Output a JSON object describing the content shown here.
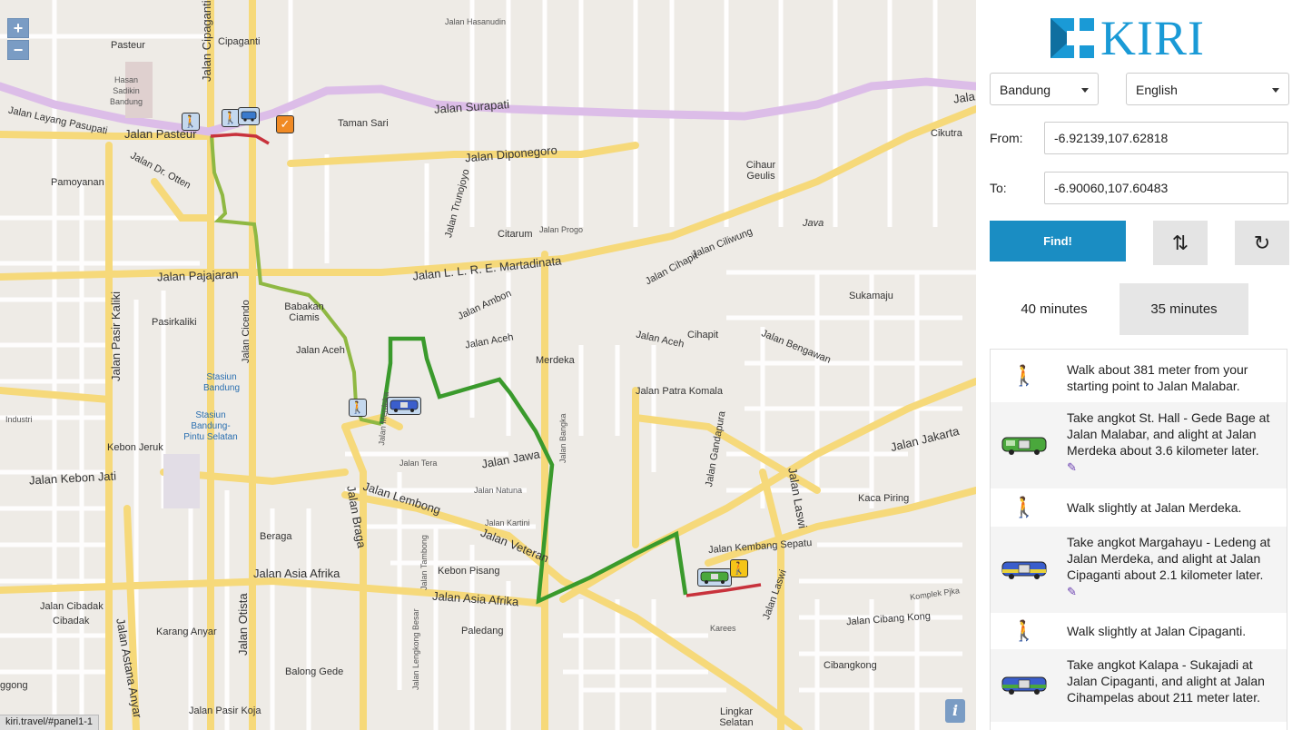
{
  "map": {
    "zoom_in": "+",
    "zoom_out": "−",
    "info": "i",
    "status_url": "kiri.travel/#panel1-1",
    "places": {
      "pasteur": "Pasteur",
      "cipaganti": "Cipaganti",
      "hasan": "Hasan Sadikin Bandung",
      "taman_sari": "Taman Sari",
      "pamoyanan": "Pamoyanan",
      "cihaur": "Cihaur Geulis",
      "citarum": "Citarum",
      "java": "Java",
      "cikutra": "Cikutra",
      "babakan": "Babakan Ciamis",
      "pasirkaliki": "Pasirkaliki",
      "sukamaju": "Sukamaju",
      "merdeka": "Merdeka",
      "cihapit": "Cihapit",
      "stasiun": "Stasiun Bandung",
      "stasiun2": "Stasiun Bandung-Pintu Selatan",
      "kebon_jeruk": "Kebon Jeruk",
      "kaca_piring": "Kaca Piring",
      "beraga": "Beraga",
      "kebon_pisang": "Kebon Pisang",
      "cibadak": "Cibadak",
      "karang_anyar": "Karang Anyar",
      "paledang": "Paledang",
      "balong_gede": "Balong Gede",
      "cibangkong": "Cibangkong",
      "lingkar": "Lingkar Selatan",
      "ggong": "ggong"
    },
    "streets": {
      "hasanudin": "Jalan Hasanudin",
      "surapati": "Jalan Surapati",
      "layang": "Jalan Layang Pasupati",
      "pasteur": "Jalan Pasteur",
      "dipongoro": "Jalan Diponegoro",
      "dr_otten": "Jalan Dr. Otten",
      "pajajaran": "Jalan Pajajaran",
      "martadinata": "Jalan L. L. R. E. Martadinata",
      "ambon": "Jalan Ambon",
      "aceh": "Jalan Aceh",
      "aceh2": "Jalan Aceh",
      "aceh3": "Jalan Aceh",
      "cihapit": "Jalan Cihapit",
      "ciliwung": "Jalan Ciliwung",
      "cipaganti": "Jalan Cipaganti",
      "cicendo": "Jalan Cicendo",
      "pasir_kaliki": "Jalan Pasir Kaliki",
      "kebon_jati": "Jalan Kebon Jati",
      "jawa": "Jalan Jawa",
      "lembong": "Jalan Lembong",
      "veteran": "Jalan Veteran",
      "asia_afrika": "Jalan Asia Afrika",
      "asia_afrika2": "Jalan Asia Afrika",
      "braga": "Jalan Braga",
      "otista": "Jalan Otista",
      "laswi": "Jalan Laswi",
      "laswi2": "Jalan Laswi",
      "jakarta": "Jalan Jakarta",
      "gandapura": "Jalan Gandapura",
      "kembang_sepatu": "Jalan Kembang Sepatu",
      "astana_anyar": "Jalan Astana Anyar",
      "pasir_koja": "Jalan Pasir Koja",
      "cibadak": "Jalan Cibadak",
      "cibang_kong": "Jalan Cibang Kong",
      "bengawan": "Jalan Bengawan",
      "patra": "Jalan Patra Komala",
      "trunojoyo": "Jalan Trunojoyo",
      "progo": "Jalan Progo",
      "tera": "Jalan Tera",
      "natuna": "Jalan Natuna",
      "kartini": "Jalan Kartini",
      "lengkong": "Jalan Lengkong Besar",
      "tambong": "Jalan Tambong",
      "bangka": "Jalan Bangka",
      "komplek": "Komplek Pjka",
      "industri": "Industri",
      "karees": "Karees",
      "merdeka": "Jalan Merdeka",
      "jala": "Jala"
    }
  },
  "sidebar": {
    "logo_text": "KIRI",
    "city": "Bandung",
    "language": "English",
    "from_label": "From:",
    "from_value": "-6.92139,107.62818",
    "to_label": "To:",
    "to_value": "-6.90060,107.60483",
    "find_label": "Find!",
    "swap_icon": "⇅",
    "reset_icon": "↻",
    "tabs": [
      {
        "label": "40 minutes",
        "active": true
      },
      {
        "label": "35 minutes",
        "active": false
      }
    ],
    "steps": [
      {
        "icon": "walk",
        "text": "Walk about 381 meter from your starting point to Jalan Malabar.",
        "edit": false
      },
      {
        "icon": "angkot-green",
        "text": "Take angkot St. Hall - Gede Bage at Jalan Malabar, and alight at Jalan Merdeka about 3.6 kilometer later.",
        "edit": true
      },
      {
        "icon": "walk",
        "text": "Walk slightly at Jalan Merdeka.",
        "edit": false
      },
      {
        "icon": "angkot-blue",
        "text": "Take angkot Margahayu - Ledeng at Jalan Merdeka, and alight at Jalan Cipaganti about 2.1 kilometer later.",
        "edit": true
      },
      {
        "icon": "walk",
        "text": "Walk slightly at Jalan Cipaganti.",
        "edit": false
      },
      {
        "icon": "angkot-blue",
        "text": "Take angkot Kalapa - Sukajadi at Jalan Cipaganti, and alight at Jalan Cihampelas about 211 meter later.",
        "edit": false
      }
    ],
    "colors": {
      "accent": "#1a8dc3",
      "logo": "#1a9ad6",
      "route_light": "#8fb843",
      "route_dark": "#3a9a2c",
      "route_walk": "#c8323c",
      "flyover": "#d9b8e6"
    }
  }
}
